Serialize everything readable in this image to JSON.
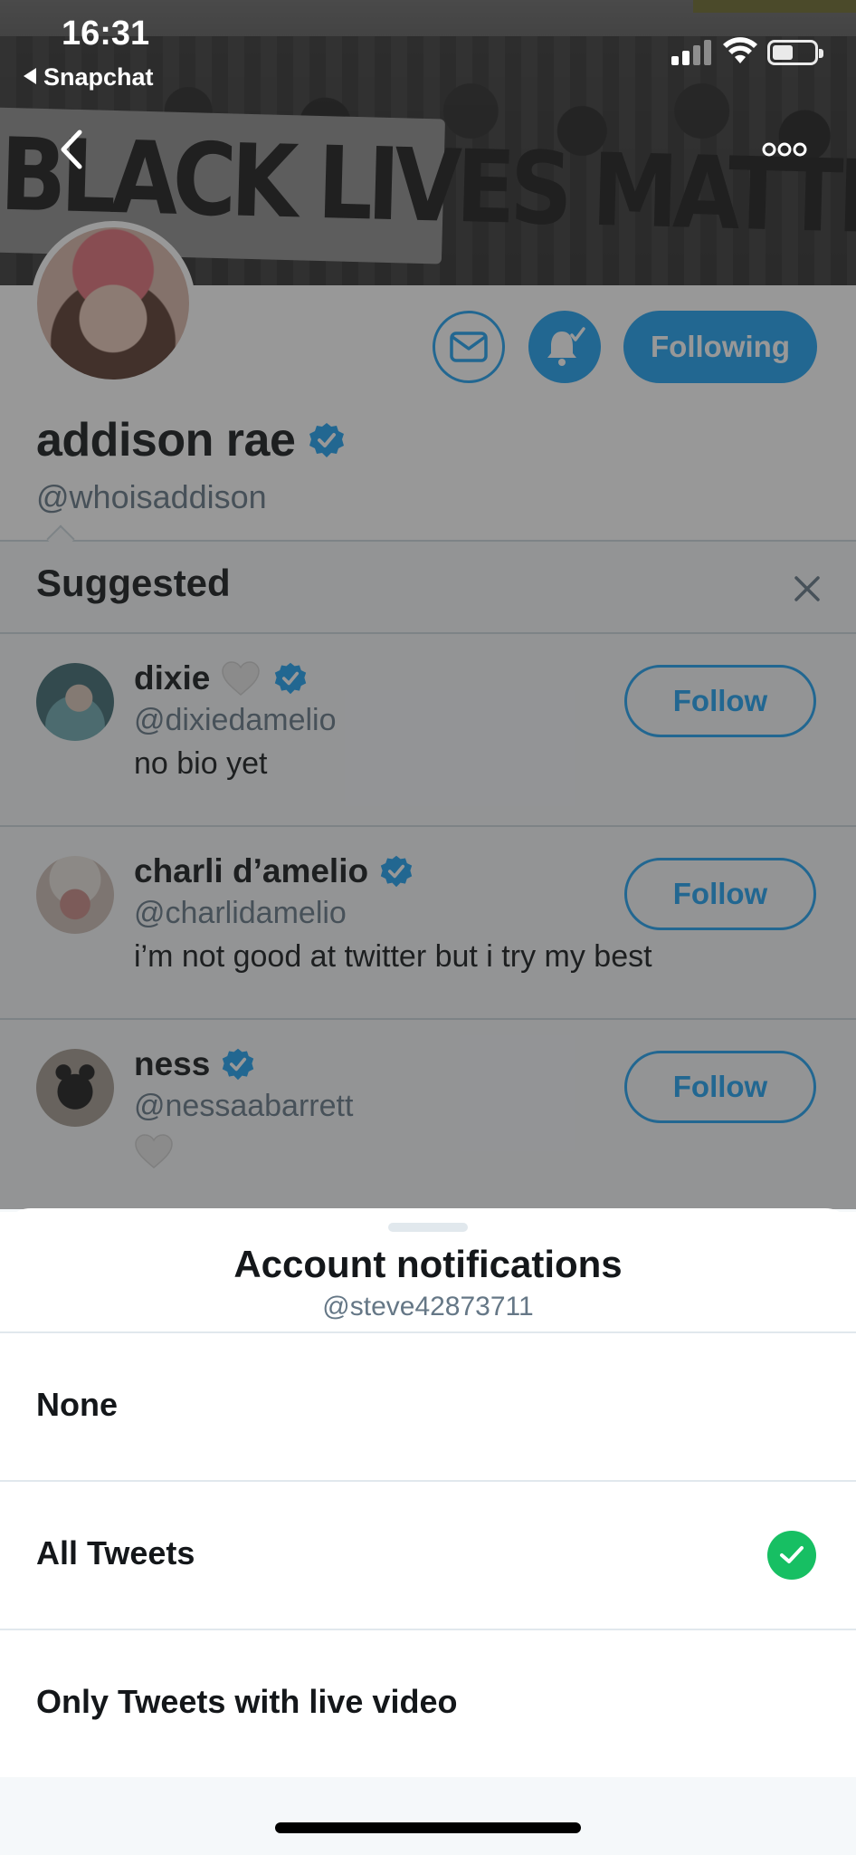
{
  "status_bar": {
    "time": "16:31",
    "back_app": "Snapchat"
  },
  "banner": {
    "sign_text": "BLACK LIVES MATTER."
  },
  "profile": {
    "name": "addison rae",
    "handle": "@whoisaddison",
    "following_label": "Following",
    "accent_color": "#1da1f2"
  },
  "suggested": {
    "title": "Suggested",
    "follow_label": "Follow",
    "items": [
      {
        "name": "dixie",
        "handle": "@dixiedamelio",
        "bio": "no bio yet",
        "name_heart": true
      },
      {
        "name": "charli d’amelio",
        "handle": "@charlidamelio",
        "bio": "i’m not good at twitter but i try my best",
        "name_heart": false
      },
      {
        "name": "ness",
        "handle": "@nessaabarrett",
        "bio": "",
        "bio_heart": true
      }
    ]
  },
  "sheet": {
    "title": "Account notifications",
    "subtitle": "@steve42873711",
    "options": [
      {
        "label": "None",
        "selected": false
      },
      {
        "label": "All Tweets",
        "selected": true
      },
      {
        "label": "Only Tweets with live video",
        "selected": false
      }
    ],
    "check_color": "#17bf63"
  }
}
